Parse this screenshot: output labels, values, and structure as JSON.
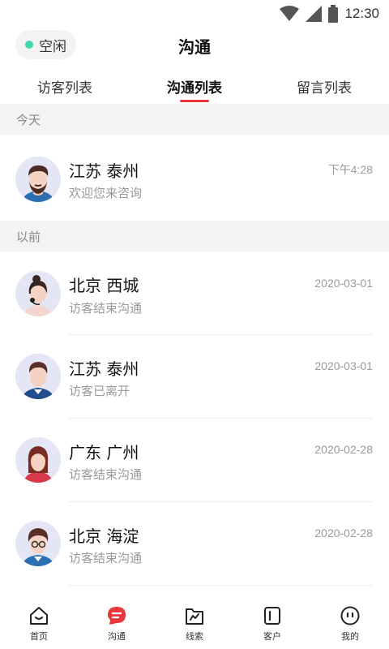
{
  "status_bar": {
    "time": "12:30"
  },
  "header": {
    "status_label": "空闲",
    "status_color": "#43d7b0",
    "title": "沟通"
  },
  "tabs": [
    {
      "label": "访客列表",
      "active": false
    },
    {
      "label": "沟通列表",
      "active": true
    },
    {
      "label": "留言列表",
      "active": false
    }
  ],
  "accent_color": "#e8373a",
  "sections": {
    "today": {
      "label": "今天"
    },
    "earlier": {
      "label": "以前"
    }
  },
  "conversations": [
    {
      "name": "江苏 泰州",
      "preview": "欢迎您来咨询",
      "time": "下午4:28",
      "avatar": "man-beard-avatar"
    },
    {
      "name": "北京 西城",
      "preview": "访客结束沟通",
      "time": "2020-03-01",
      "avatar": "woman-headset-avatar"
    },
    {
      "name": "江苏 泰州",
      "preview": "访客已离开",
      "time": "2020-03-01",
      "avatar": "man-avatar"
    },
    {
      "name": "广东 广州",
      "preview": "访客结束沟通",
      "time": "2020-02-28",
      "avatar": "woman-avatar"
    },
    {
      "name": "北京 海淀",
      "preview": "访客结束沟通",
      "time": "2020-02-28",
      "avatar": "man-glasses-avatar"
    }
  ],
  "bottom_nav": [
    {
      "label": "首页",
      "icon": "home-icon",
      "active": false
    },
    {
      "label": "沟通",
      "icon": "chat-icon",
      "active": true
    },
    {
      "label": "线索",
      "icon": "leads-icon",
      "active": false
    },
    {
      "label": "客户",
      "icon": "customer-icon",
      "active": false
    },
    {
      "label": "我的",
      "icon": "profile-icon",
      "active": false
    }
  ]
}
